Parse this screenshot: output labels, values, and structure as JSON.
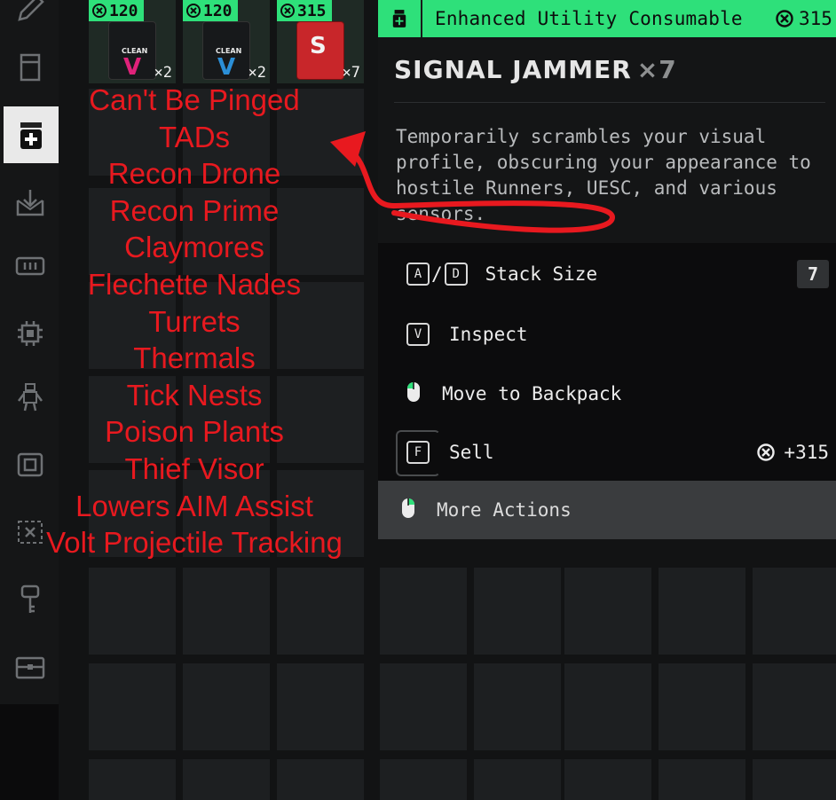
{
  "sidebar": {
    "items": [
      {
        "icon": "pencil-icon",
        "active": false
      },
      {
        "icon": "container-icon",
        "active": false
      },
      {
        "icon": "consumable-plus-icon",
        "active": true
      },
      {
        "icon": "download-tray-icon",
        "active": false
      },
      {
        "icon": "battery-icon",
        "active": false
      },
      {
        "icon": "chip-icon",
        "active": false
      },
      {
        "icon": "robot-icon",
        "active": false
      },
      {
        "icon": "core-icon",
        "active": false
      },
      {
        "icon": "crossed-box-icon",
        "active": false
      },
      {
        "icon": "key-icon",
        "active": false
      },
      {
        "icon": "case-icon",
        "active": false
      }
    ]
  },
  "inventory": {
    "items": [
      {
        "price": "120",
        "quantity": "×2",
        "label": "CLEAN",
        "color": "#e0227a"
      },
      {
        "price": "120",
        "quantity": "×2",
        "label": "CLEAN",
        "color": "#2b8fd8"
      },
      {
        "price": "315",
        "quantity": "×7",
        "label": "",
        "color": "#d8292b"
      }
    ]
  },
  "detail": {
    "category": "Enhanced Utility Consumable",
    "price": "315",
    "name": "SIGNAL JAMMER",
    "multiplier": "×7",
    "description": "Temporarily scrambles your visual profile, obscuring your appearance to hostile Runners, UESC, and various sensors.",
    "accent_color": "#2ee07a"
  },
  "actions": {
    "stack_keys": [
      "A",
      "D"
    ],
    "stack_separator": "/",
    "stack_label": "Stack Size",
    "stack_value": "7",
    "inspect_key": "V",
    "inspect_label": "Inspect",
    "move_label": "Move to Backpack",
    "sell_key": "F",
    "sell_label": "Sell",
    "sell_value": "+315",
    "more_label": "More Actions"
  },
  "annotation": {
    "color": "#e8191f",
    "lines": [
      "Can't Be Pinged",
      "TADs",
      "Recon Drone",
      "Recon Prime",
      "Claymores",
      "Flechette Nades",
      "Turrets",
      "Thermals",
      "Tick Nests",
      "Poison Plants",
      "Thief Visor",
      "Lowers AIM Assist",
      "Volt Projectile Tracking"
    ]
  }
}
